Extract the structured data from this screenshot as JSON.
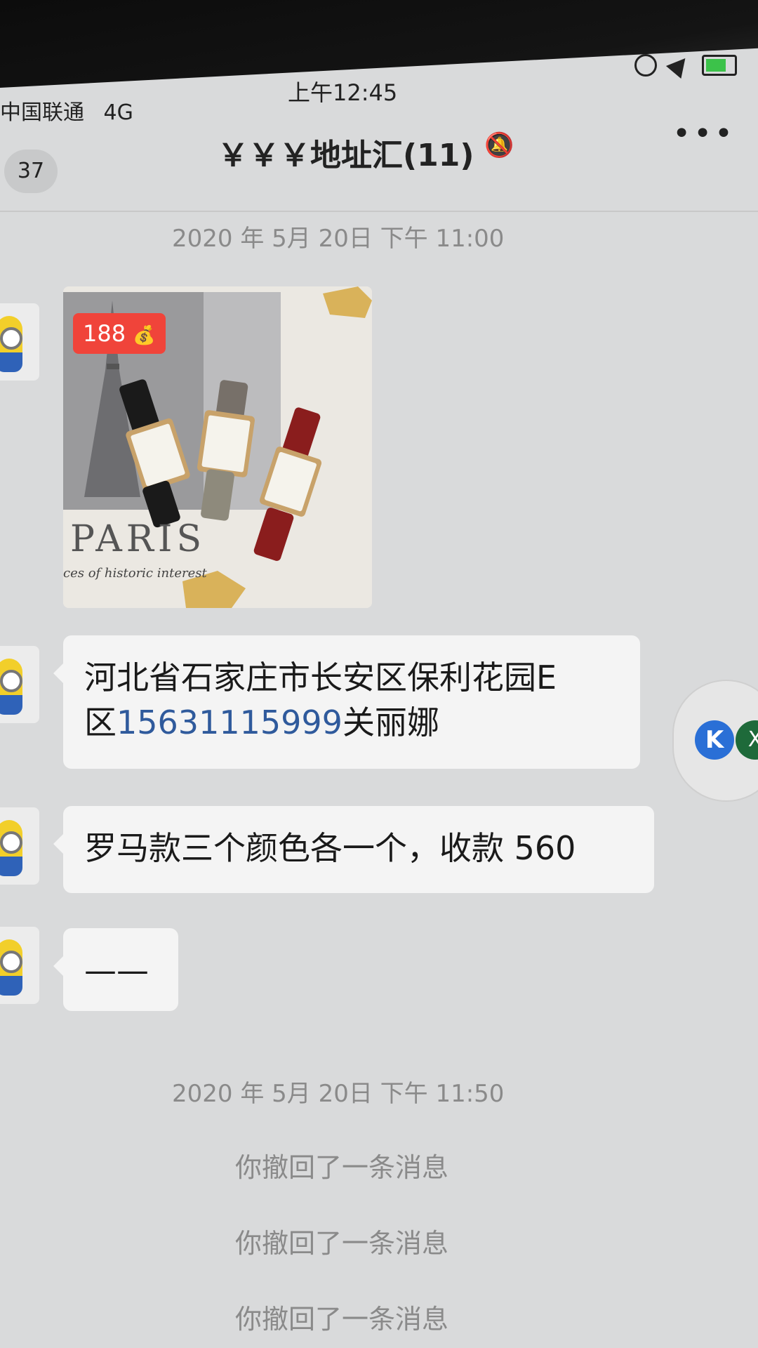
{
  "status_bar": {
    "carrier": "中国联通",
    "network": "4G",
    "time": "上午12:45"
  },
  "header": {
    "unread_count": "37",
    "title": "￥￥￥地址汇(11)",
    "mute_icon": "bell-slash-icon",
    "more_icon": "more-icon"
  },
  "timestamps": {
    "first": "2020 年 5月 20日  下午 11:00",
    "second": "2020 年 5月 20日  下午 11:50"
  },
  "messages": {
    "image": {
      "price_label": "188",
      "paris_text": "PARIS",
      "paris_sub": "ces of historic interest"
    },
    "address_line1": "河北省石家庄市长安区保利花园E",
    "address_prefix": "区",
    "address_phone": "15631115999",
    "address_name": "关丽娜",
    "order_note": "罗马款三个颜色各一个，收款 560",
    "dash": "——"
  },
  "floating": {
    "k_label": "K",
    "x_label": "X"
  },
  "system_notices": [
    "你撤回了一条消息",
    "你撤回了一条消息",
    "你撤回了一条消息"
  ],
  "colors": {
    "background": "#d9dadb",
    "bubble": "#f4f4f4",
    "price_tag": "#f0443a",
    "link": "#2f5a9c"
  }
}
